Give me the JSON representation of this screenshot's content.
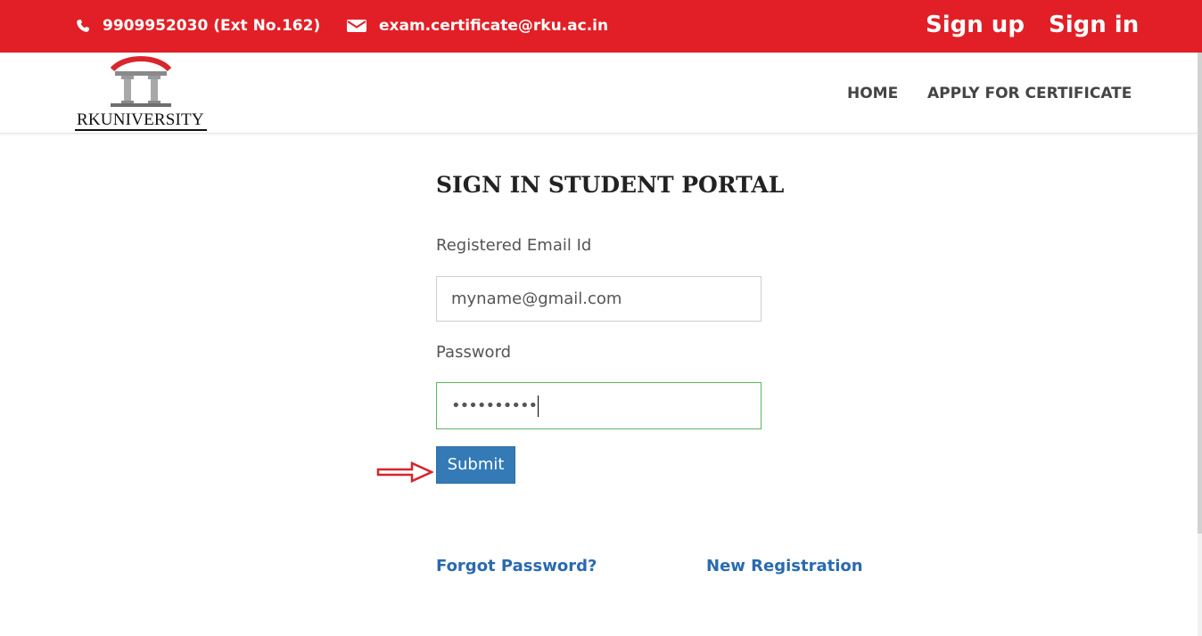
{
  "topbar": {
    "phone": "9909952030 (Ext No.162)",
    "email": "exam.certificate@rku.ac.in",
    "signup_label": "Sign up",
    "signin_label": "Sign in",
    "phone_icon": "phone-icon",
    "email_icon": "envelope-icon",
    "background_color": "#e21f26"
  },
  "navbar": {
    "logo_text": "RKUNIVERSITY",
    "home_label": "HOME",
    "apply_label": "APPLY FOR CERTIFICATE"
  },
  "form": {
    "title": "SIGN IN STUDENT PORTAL",
    "email_label": "Registered Email Id",
    "email_value": "myname@gmail.com",
    "password_label": "Password",
    "password_value": "••••••••••",
    "submit_label": "Submit",
    "submit_color": "#337ab7"
  },
  "links": {
    "forgot_password": "Forgot Password?",
    "new_registration": "New Registration"
  },
  "annotation": {
    "arrow_icon": "red-outline-arrow-icon",
    "arrow_color": "#d8242b"
  }
}
